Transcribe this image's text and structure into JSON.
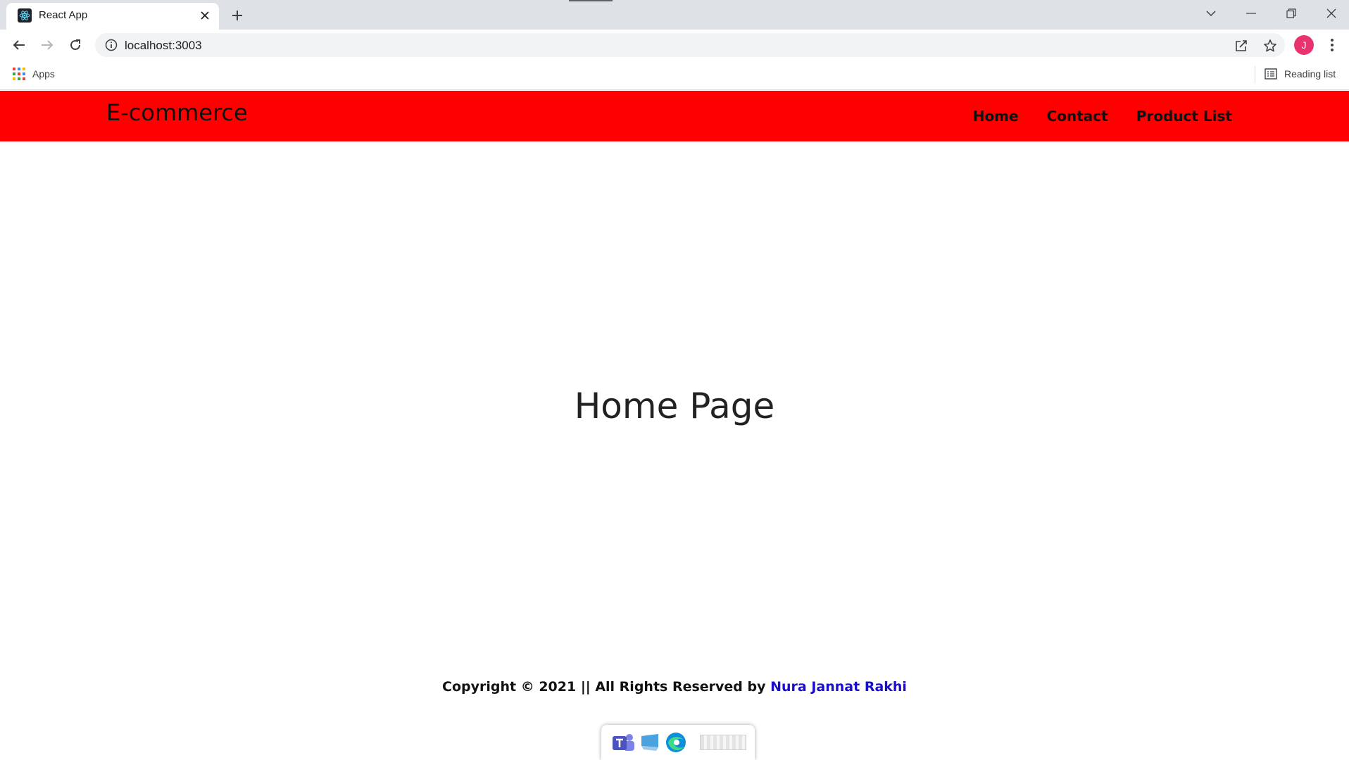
{
  "browser": {
    "tab": {
      "title": "React App",
      "favicon": "react-logo-icon"
    },
    "address": {
      "url": "localhost:3003"
    },
    "profile": {
      "initial": "J",
      "color": "#e8336f"
    },
    "bookmarks": {
      "apps_label": "Apps",
      "reading_list_label": "Reading list"
    }
  },
  "navbar": {
    "brand": "E-commerce",
    "background": "#ff0000",
    "links": [
      "Home",
      "Contact",
      "Product List"
    ]
  },
  "main": {
    "heading": "Home Page"
  },
  "footer": {
    "prefix": "Copyright © 2021 || All Rights Reserved by ",
    "author": "Nura Jannat Rakhi",
    "author_color": "#1a0dcc"
  },
  "taskbar_preview": {
    "icons": [
      "teams-icon",
      "computer-icon",
      "edge-icon"
    ]
  }
}
